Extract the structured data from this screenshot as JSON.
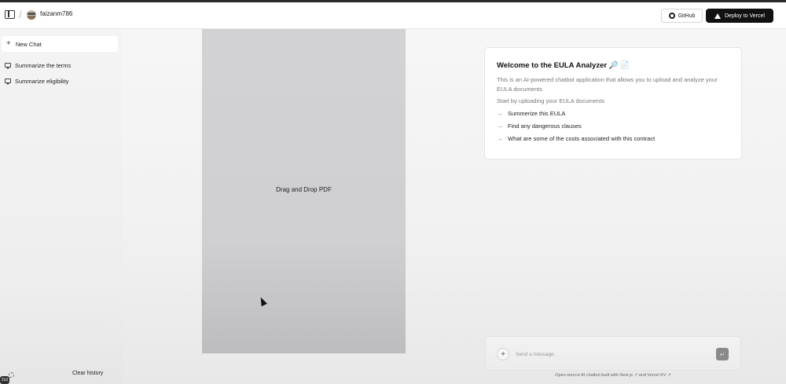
{
  "header": {
    "username": "faizanm786",
    "github_label": "GitHub",
    "deploy_label": "Deploy to Vercel",
    "separator": "/"
  },
  "sidebar": {
    "new_chat_label": "New Chat",
    "items": [
      {
        "label": "Summarize the terms"
      },
      {
        "label": "Summarize eligibility"
      }
    ],
    "clear_history_label": "Clear history",
    "badge_text": "2x3"
  },
  "dropzone": {
    "label": "Drag and Drop PDF"
  },
  "welcome": {
    "title": "Welcome to the EULA Analyzer",
    "title_emoji": "🔎 📄",
    "description": "This is an AI-powered chatbot application that allows you to upload and analyze your EULA documents",
    "start_text": "Start by uploading your EULA documents",
    "suggestions": [
      {
        "label": "Summerize this EULA"
      },
      {
        "label": "Find any dangerous clauses"
      },
      {
        "label": "What are some of the costs associated with this contract"
      }
    ]
  },
  "composer": {
    "placeholder": "Send a message.",
    "footer": "Open source AI chatbot built with Next.js ↗ and Vercel KV ↗"
  },
  "icons": {
    "sidebar_toggle": "sidebar-toggle-icon",
    "github": "github-icon",
    "deploy": "triangle-icon",
    "plus": "plus-icon",
    "chat": "message-bubble-icon",
    "arrow": "arrow-right-icon",
    "send": "send-icon",
    "settings": "gear-icon",
    "cursor": "mouse-pointer-icon"
  }
}
